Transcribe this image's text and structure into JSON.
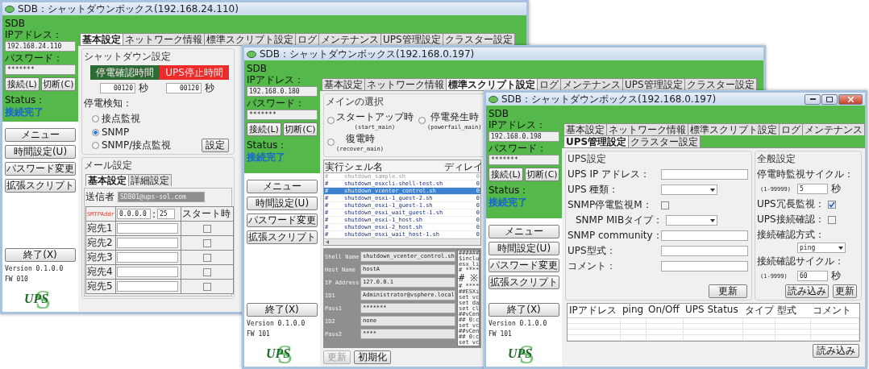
{
  "windows": [
    {
      "kind": "basic",
      "title": "SDB：シャットダウンボックス(192.168.24.110)",
      "has_controls": false,
      "sidebar": {
        "ip_label": "SDB IPアドレス：",
        "ip": "192.168.24.110",
        "password_label": "パスワード：",
        "password": "*******",
        "connect": "接続(L)",
        "disconnect": "切断(C)",
        "status_label": "Status：",
        "status": "接続完了",
        "menu": [
          "メニュー",
          "時間設定(U)",
          "パスワード変更",
          "拡張スクリプト"
        ],
        "exit": "終了(X)",
        "version": "Version 0.1.0.0",
        "fw": "FW 010",
        "logo": {
          "letter": "S",
          "text": "UPS"
        }
      },
      "tabs": [
        {
          "label": "基本設定",
          "selected": true
        },
        {
          "label": "ネットワーク情報",
          "selected": false
        },
        {
          "label": "標準スクリプト設定",
          "selected": false
        },
        {
          "label": "ログ",
          "selected": false
        },
        {
          "label": "メンテナンス",
          "selected": false
        },
        {
          "label": "UPS管理設定",
          "selected": false
        },
        {
          "label": "クラスター設定",
          "selected": false
        }
      ],
      "content": {
        "shutdown": {
          "title": "シャットダウン設定",
          "banner": [
            {
              "label": "停電確認時間",
              "color": "#2c6a36"
            },
            {
              "label": "UPS停止時間",
              "color": "#ec2b2b"
            }
          ],
          "times": [
            {
              "value": "00120",
              "unit": "秒"
            },
            {
              "value": "00120",
              "unit": "秒"
            }
          ],
          "detect_label": "停電検知：",
          "options": [
            {
              "label": "接点監視",
              "selected": false
            },
            {
              "label": "SNMP",
              "selected": true
            },
            {
              "label": "SNMP/接点監視",
              "selected": false
            }
          ],
          "set_button": "設定"
        },
        "mail": {
          "title": "メール設定",
          "tabs": [
            {
              "label": "基本設定",
              "selected": true
            },
            {
              "label": "詳細設定",
              "selected": false
            }
          ],
          "sender_label": "送信者",
          "sender": "SDB01@ups-sol.com",
          "smtp_label": "SMTPAddr",
          "smtp": "0.0.0.0",
          "port_sep": ":",
          "port": "25",
          "column": "スタート時",
          "recipients": [
            {
              "label": "宛先1",
              "checked": false
            },
            {
              "label": "宛先2",
              "checked": false
            },
            {
              "label": "宛先3",
              "checked": false
            },
            {
              "label": "宛先4",
              "checked": false
            },
            {
              "label": "宛先5",
              "checked": false
            }
          ]
        }
      }
    },
    {
      "kind": "script",
      "title": "SDB：シャットダウンボックス(192.168.0.197)",
      "has_controls": false,
      "sidebar": {
        "ip_label": "SDB IPアドレス：",
        "ip": "192.168.0.180",
        "password_label": "パスワード：",
        "password": "*******",
        "connect": "接続(L)",
        "disconnect": "切断(C)",
        "status_label": "Status：",
        "status": "接続完了",
        "menu": [
          "メニュー",
          "時間設定(U)",
          "パスワード変更",
          "拡張スクリプト"
        ],
        "exit": "終了(X)",
        "version": "Version 0.1.0.0",
        "fw": "FW 101",
        "logo": {
          "letter": "S",
          "text": "UPS"
        }
      },
      "tabs": [
        {
          "label": "基本設定",
          "selected": false
        },
        {
          "label": "ネットワーク情報",
          "selected": false
        },
        {
          "label": "標準スクリプト設定",
          "selected": true
        },
        {
          "label": "ログ",
          "selected": false
        },
        {
          "label": "メンテナンス",
          "selected": false
        },
        {
          "label": "UPS管理設定",
          "selected": false
        },
        {
          "label": "クラスター設定",
          "selected": false
        }
      ],
      "content": {
        "main_select": {
          "title": "メインの選択",
          "options": [
            {
              "label": "スタートアップ時",
              "sub": "(start_main)",
              "selected": false
            },
            {
              "label": "停電発生時",
              "sub": "(powerfail_main)",
              "selected": false
            },
            {
              "label": "復電時",
              "sub": "(recover_main)",
              "selected": false
            }
          ]
        },
        "scripts": {
          "columns": [
            "実行",
            "シェル名",
            "ディレイ"
          ],
          "rows": [
            {
              "mark": "#",
              "name": "shutdown_sample.sh",
              "delay": "0",
              "selected": false,
              "disabled": true
            },
            {
              "mark": "#",
              "name": "shutdown_esxcli-shell-test.sh",
              "delay": "0",
              "selected": false,
              "disabled": false
            },
            {
              "mark": "#",
              "name": "shutdown_vcenter_control.sh",
              "delay": "0",
              "selected": true,
              "disabled": false
            },
            {
              "mark": "#",
              "name": "shutdown_esxi-1_guest-2.sh",
              "delay": "0",
              "selected": false,
              "disabled": false
            },
            {
              "mark": "#",
              "name": "shutdown_esxi-1_guest-1.sh",
              "delay": "0",
              "selected": false,
              "disabled": false
            },
            {
              "mark": "#",
              "name": "shutdown_esxi_wait_guest-1.sh",
              "delay": "0",
              "selected": false,
              "disabled": false
            },
            {
              "mark": "#",
              "name": "shutdown_esxi-1_host.sh",
              "delay": "0",
              "selected": false,
              "disabled": false
            },
            {
              "mark": "#",
              "name": "shutdown_esxi-2_host.sh",
              "delay": "0",
              "selected": false,
              "disabled": false
            },
            {
              "mark": "#",
              "name": "shutdown_esxi_wait_host-1.sh",
              "delay": "0",
              "selected": false,
              "disabled": false
            }
          ]
        },
        "detail": {
          "fields": [
            {
              "label": "Shell Name",
              "value": "shutdown_vcenter_control.sh"
            },
            {
              "label": "Host Name",
              "value": "hostA"
            },
            {
              "label": "IP Address",
              "value": "127.0.0.1"
            },
            {
              "label": "ID1",
              "value": "Administrator@vsphere.local"
            },
            {
              "label": "Pass1",
              "value": "*******"
            },
            {
              "label": "ID2",
              "value": "none"
            },
            {
              "label": "Pass2",
              "value": "****"
            }
          ],
          "lines": [
            {
              "kind": "code",
              "text": "######"
            },
            {
              "kind": "code",
              "text": "$inclu"
            },
            {
              "kind": "code",
              "text": "esx_li"
            },
            {
              "kind": "code",
              "text": "# ****"
            },
            {
              "kind": "jp",
              "text": "# ※"
            },
            {
              "kind": "code",
              "text": "# ****"
            },
            {
              "kind": "code",
              "text": "##ESXi"
            },
            {
              "kind": "code",
              "text": "set vc"
            },
            {
              "kind": "code",
              "text": "set da"
            },
            {
              "kind": "code",
              "text": "set cl"
            },
            {
              "kind": "code",
              "text": "##vCen"
            },
            {
              "kind": "code",
              "text": "## 0:c"
            },
            {
              "kind": "code",
              "text": "set vc"
            },
            {
              "kind": "code",
              "text": "##vCen"
            },
            {
              "kind": "code",
              "text": "## 0:c"
            },
            {
              "kind": "code",
              "text": "set vc"
            }
          ],
          "buttons": [
            {
              "label": "更新",
              "disabled": true
            },
            {
              "label": "初期化",
              "disabled": false
            }
          ]
        }
      }
    },
    {
      "kind": "ups",
      "title": "SDB：シャットダウンボックス(192.168.0.197)",
      "has_controls": true,
      "sidebar": {
        "ip_label": "SDB IPアドレス：",
        "ip": "192.168.0.198",
        "password_label": "パスワード：",
        "password": "*******",
        "connect": "接続(L)",
        "disconnect": "切断(C)",
        "status_label": "Status：",
        "status": "接続完了",
        "menu": [
          "メニュー",
          "時間設定(U)",
          "パスワード変更",
          "拡張スクリプト"
        ],
        "exit": "終了(X)",
        "version": "Version 0.1.0.0",
        "fw": "FW 101",
        "logo": {
          "letter": "S",
          "text": "UPS"
        }
      },
      "tabs": [
        {
          "label": "基本設定",
          "selected": false
        },
        {
          "label": "ネットワーク情報",
          "selected": false
        },
        {
          "label": "標準スクリプト設定",
          "selected": false
        },
        {
          "label": "ログ",
          "selected": false
        },
        {
          "label": "メンテナンス",
          "selected": false
        },
        {
          "label": "UPS管理設定",
          "selected": true
        },
        {
          "label": "クラスター設定",
          "selected": false
        }
      ],
      "content": {
        "ups": {
          "title": "UPS設定",
          "rows": [
            {
              "kind": "input",
              "label": "UPS IP アドレス："
            },
            {
              "kind": "select",
              "label": "UPS 種類："
            },
            {
              "kind": "check_select",
              "label": "SNMP停電監視M：",
              "checked": false,
              "label2": "SNMP MIBタイプ："
            },
            {
              "kind": "input",
              "label": "SNMP community："
            },
            {
              "kind": "input",
              "label": "UPS型式："
            },
            {
              "kind": "input",
              "label": "コメント："
            }
          ],
          "button": "更新"
        },
        "general": {
          "title": "全般設定",
          "rows": [
            {
              "kind": "cycle",
              "label": "停電時監視サイクル：",
              "hint": "(1-99999)",
              "value": "5",
              "unit": "秒"
            },
            {
              "kind": "check",
              "label": "UPS冗長監視：",
              "checked": true
            },
            {
              "kind": "check",
              "label": "UPS接続確認：",
              "checked": false
            },
            {
              "kind": "select",
              "label": "接続確認方式：",
              "value": "ping"
            },
            {
              "kind": "cycle",
              "label": "接続確認サイクル：",
              "hint": "(1-9999)",
              "value": "60",
              "unit": "秒"
            }
          ],
          "buttons": [
            "読み込み",
            "更新"
          ]
        },
        "table": {
          "columns": [
            "IPアドレス",
            "ping",
            "On/Off",
            "UPS Status",
            "タイプ",
            "型式",
            "コメント"
          ],
          "button": "読み込み"
        }
      }
    }
  ]
}
